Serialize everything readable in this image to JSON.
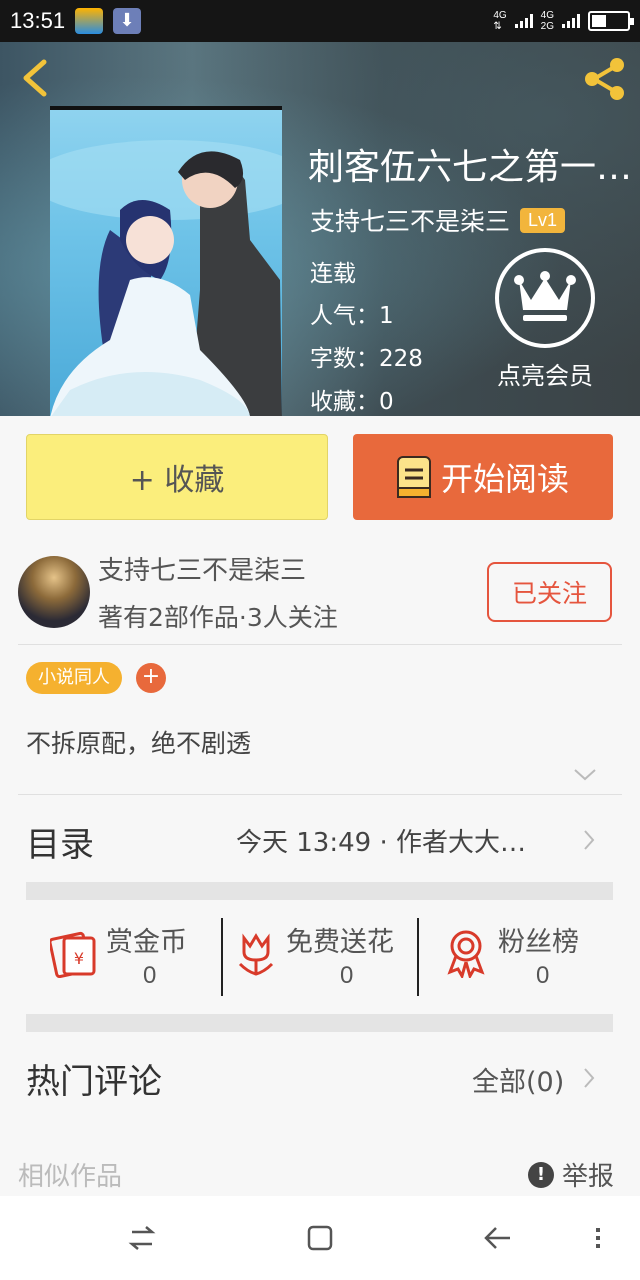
{
  "status_bar": {
    "time": "13:51",
    "network_top": "4G",
    "network_top2": "4G",
    "network_bottom": "2G",
    "icons": [
      "weather-app-icon",
      "download-icon",
      "signal-icon",
      "battery-icon"
    ]
  },
  "book": {
    "title": "刺客伍六七之第一…",
    "author": "支持七三不是柒三",
    "level": "Lv1",
    "status": "连载",
    "popularity": "人气：1",
    "word_count": "字数：228",
    "favorites": "收藏：0",
    "vip_label": "点亮会员"
  },
  "actions": {
    "collect_label": "+ 收藏",
    "read_label": "开始阅读"
  },
  "author_card": {
    "name": "支持七三不是柒三",
    "summary": "著有2部作品·3人关注",
    "follow_label": "已关注"
  },
  "tags": {
    "items": [
      "小说同人"
    ],
    "add_label": "+"
  },
  "description": "不拆原配，绝不剧透",
  "catalog": {
    "title": "目录",
    "latest": "今天 13:49 · 作者大大…"
  },
  "stats": [
    {
      "name": "赏金币",
      "value": "0",
      "icon": "reward-coin-icon"
    },
    {
      "name": "免费送花",
      "value": "0",
      "icon": "flower-icon"
    },
    {
      "name": "粉丝榜",
      "value": "0",
      "icon": "medal-icon"
    }
  ],
  "comments": {
    "title": "热门评论",
    "all_label": "全部(0)"
  },
  "footer": {
    "similar_label": "相似作品",
    "report_label": "举报",
    "report_icon": "!"
  },
  "colors": {
    "accent_orange": "#e8693c",
    "collect_yellow": "#fbee7c",
    "tag_yellow": "#f5b12f",
    "follow_red": "#e5553e",
    "level_gold": "#f2b53c",
    "icon_red": "#d83a2a"
  }
}
